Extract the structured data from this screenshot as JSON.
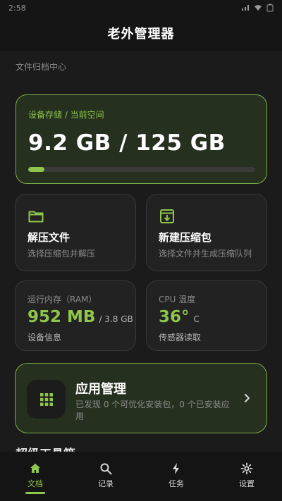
{
  "status_bar": {
    "time": "2:58"
  },
  "app": {
    "title": "老外管理器"
  },
  "section_hint": "文件归档中心",
  "storage": {
    "label": "设备存储 / 当前空间",
    "value": "9.2 GB / 125 GB",
    "used_fraction": 0.07,
    "accent": "#8fc54b"
  },
  "actions": {
    "unzip": {
      "title": "解压文件",
      "subtitle": "选择压缩包并解压",
      "icon": "folder-icon"
    },
    "new_archive": {
      "title": "新建压缩包",
      "subtitle": "选择文件并生成压缩队列",
      "icon": "archive-icon"
    }
  },
  "stats": {
    "ram": {
      "label": "运行内存（RAM）",
      "value": "952 MB",
      "total": "/ 3.8 GB",
      "footer": "设备信息"
    },
    "cpu": {
      "label": "CPU 温度",
      "value": "36°",
      "unit": "C",
      "footer": "传感器读取"
    }
  },
  "app_manage": {
    "title": "应用管理",
    "subtitle": "已发现 0 个可优化安装包，0 个已安装应用",
    "icon": "grid-icon"
  },
  "next_section": {
    "title": "超级工具箱"
  },
  "bottom_nav": {
    "items": [
      {
        "label": "文档",
        "icon": "home-icon",
        "active": true
      },
      {
        "label": "记录",
        "icon": "search-icon",
        "active": false
      },
      {
        "label": "任务",
        "icon": "bolt-icon",
        "active": false
      },
      {
        "label": "设置",
        "icon": "gear-icon",
        "active": false
      }
    ]
  },
  "colors": {
    "background": "#1b1b1b",
    "accent": "#8fc54b",
    "accent_bg": "#25301f"
  }
}
